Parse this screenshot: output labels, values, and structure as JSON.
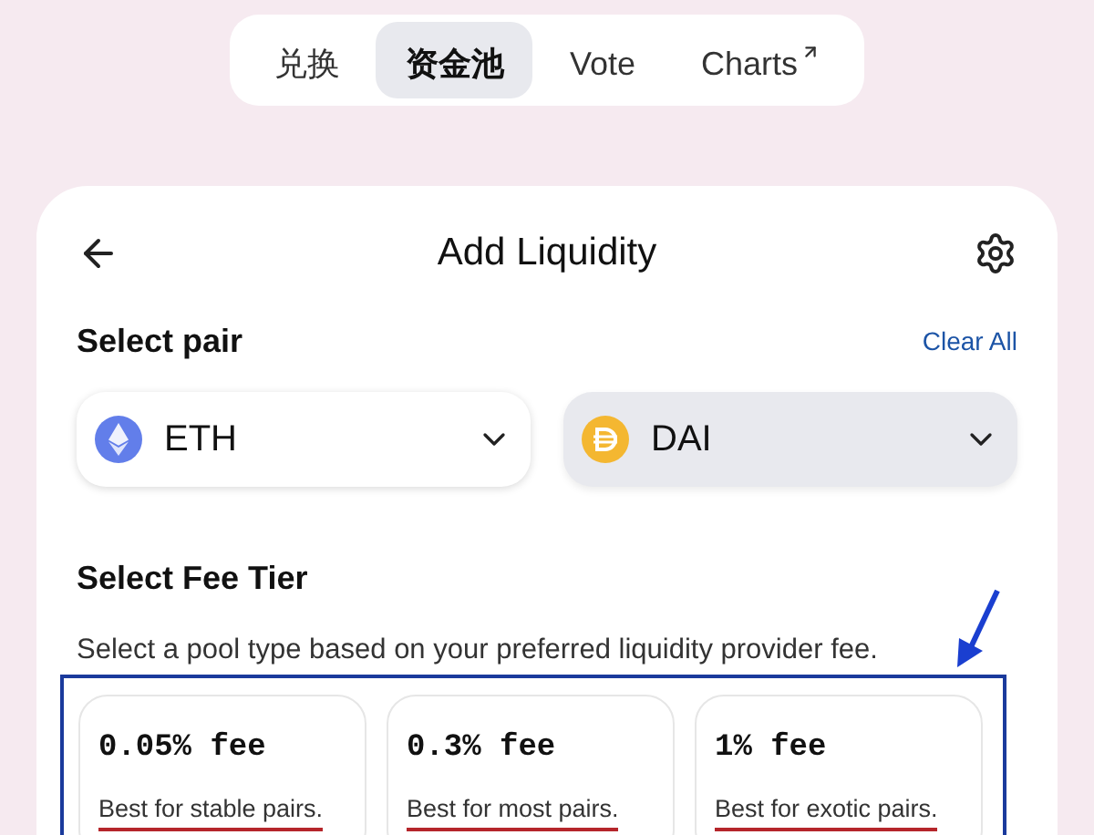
{
  "nav_tabs": [
    {
      "label": "兑换",
      "selected": false,
      "external": false
    },
    {
      "label": "资金池",
      "selected": true,
      "external": false
    },
    {
      "label": "Vote",
      "selected": false,
      "external": false
    },
    {
      "label": "Charts",
      "selected": false,
      "external": true
    }
  ],
  "card": {
    "title": "Add Liquidity",
    "pair_section": {
      "label": "Select pair",
      "clear_link": "Clear All",
      "tokens": [
        {
          "kind": "eth",
          "symbol": "ETH",
          "highlighted": false
        },
        {
          "kind": "dai",
          "symbol": "DAI",
          "highlighted": true
        }
      ]
    },
    "fee_section": {
      "label": "Select Fee Tier",
      "description": "Select a pool type based on your preferred liquidity provider fee.",
      "tiers": [
        {
          "fee": "0.05% fee",
          "note": "Best for stable pairs."
        },
        {
          "fee": "0.3% fee",
          "note": "Best for most pairs."
        },
        {
          "fee": "1% fee",
          "note": "Best for exotic pairs."
        }
      ]
    }
  }
}
